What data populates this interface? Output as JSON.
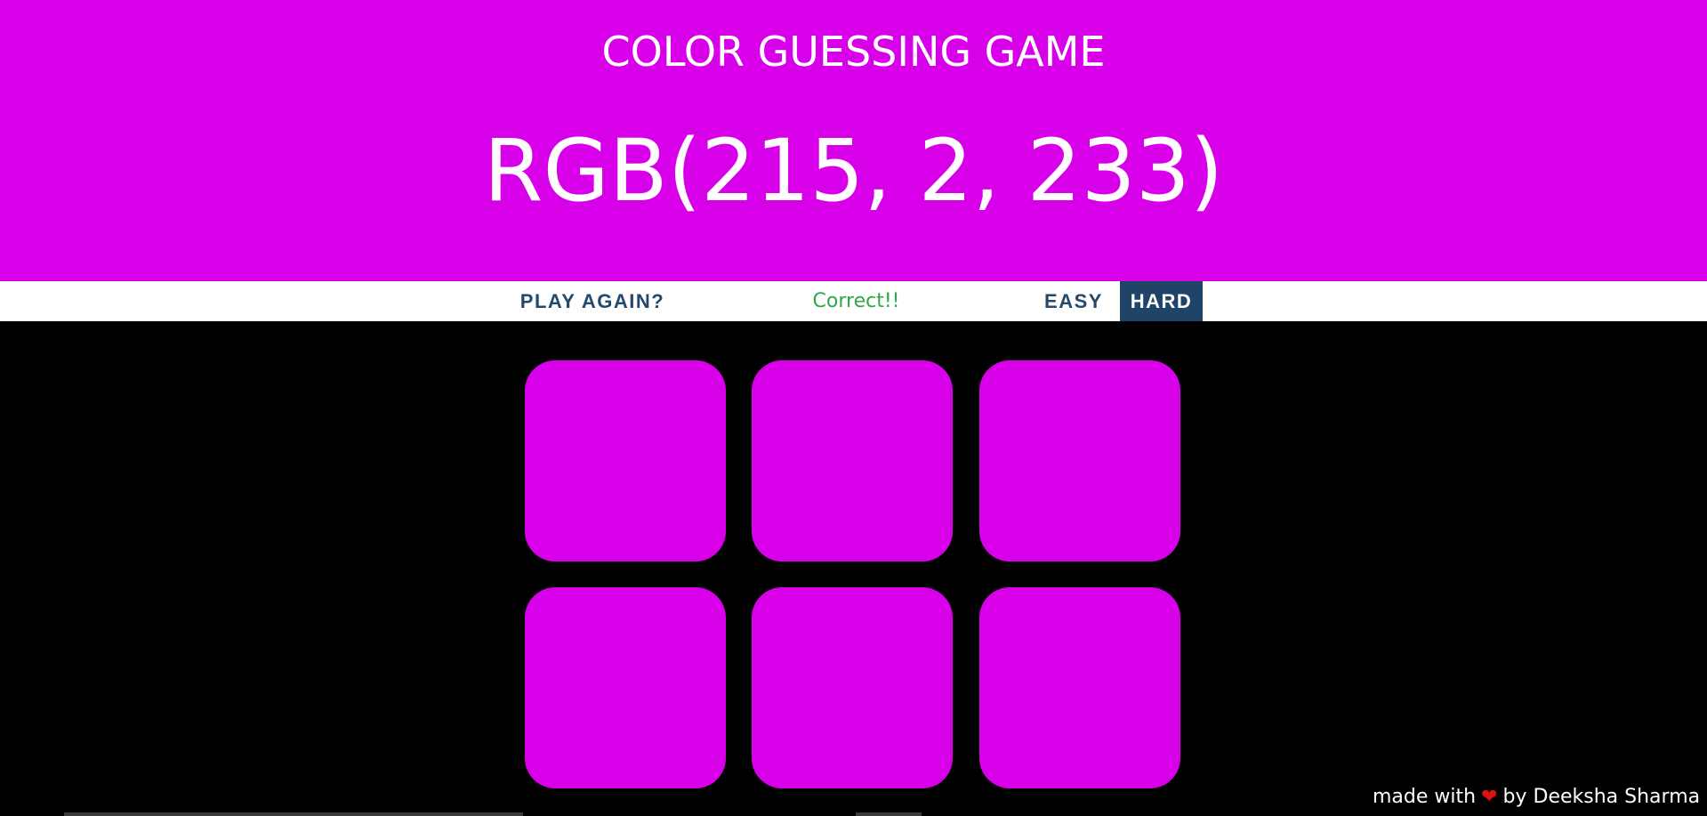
{
  "header": {
    "title": "COLOR GUESSING GAME",
    "rgb_display": "RGB(215, 2, 233)",
    "background": "#d700e9"
  },
  "stripe": {
    "reset_label": "PLAY AGAIN?",
    "message": "Correct!!",
    "easy_label": "EASY",
    "hard_label": "HARD",
    "selected_mode": "HARD",
    "selected_color": "#1f4468"
  },
  "squares": [
    {
      "color": "#d700e9"
    },
    {
      "color": "#d700e9"
    },
    {
      "color": "#d700e9"
    },
    {
      "color": "#d700e9"
    },
    {
      "color": "#d700e9"
    },
    {
      "color": "#d700e9"
    }
  ],
  "footer": {
    "prefix": "made with",
    "icon": "heart-icon",
    "suffix": "by Deeksha Sharma"
  }
}
